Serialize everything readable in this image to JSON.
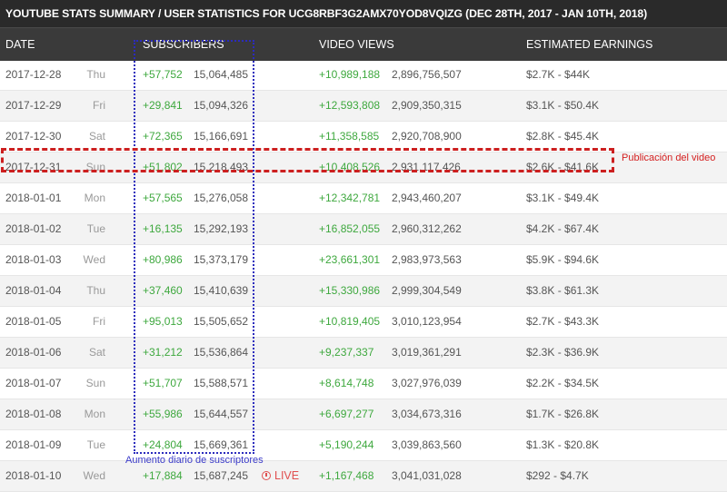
{
  "banner_title": "YOUTUBE STATS SUMMARY / USER STATISTICS FOR UCG8RBF3G2AMX70YOD8VQIZG (DEC 28TH, 2017 - JAN 10TH, 2018)",
  "columns": {
    "date": "DATE",
    "subscribers": "SUBSCRIBERS",
    "video_views": "VIDEO VIEWS",
    "earnings": "ESTIMATED EARNINGS"
  },
  "rows": [
    {
      "date": "2017-12-28",
      "day": "Thu",
      "sub_delta": "+57,752",
      "sub_total": "15,064,485",
      "views_delta": "+10,989,188",
      "views_total": "2,896,756,507",
      "earnings": "$2.7K  -  $44K"
    },
    {
      "date": "2017-12-29",
      "day": "Fri",
      "sub_delta": "+29,841",
      "sub_total": "15,094,326",
      "views_delta": "+12,593,808",
      "views_total": "2,909,350,315",
      "earnings": "$3.1K  -  $50.4K"
    },
    {
      "date": "2017-12-30",
      "day": "Sat",
      "sub_delta": "+72,365",
      "sub_total": "15,166,691",
      "views_delta": "+11,358,585",
      "views_total": "2,920,708,900",
      "earnings": "$2.8K  -  $45.4K"
    },
    {
      "date": "2017-12-31",
      "day": "Sun",
      "sub_delta": "+51,802",
      "sub_total": "15,218,493",
      "views_delta": "+10,408,526",
      "views_total": "2,931,117,426",
      "earnings": "$2.6K  -  $41.6K"
    },
    {
      "date": "2018-01-01",
      "day": "Mon",
      "sub_delta": "+57,565",
      "sub_total": "15,276,058",
      "views_delta": "+12,342,781",
      "views_total": "2,943,460,207",
      "earnings": "$3.1K  -  $49.4K"
    },
    {
      "date": "2018-01-02",
      "day": "Tue",
      "sub_delta": "+16,135",
      "sub_total": "15,292,193",
      "views_delta": "+16,852,055",
      "views_total": "2,960,312,262",
      "earnings": "$4.2K  -  $67.4K"
    },
    {
      "date": "2018-01-03",
      "day": "Wed",
      "sub_delta": "+80,986",
      "sub_total": "15,373,179",
      "views_delta": "+23,661,301",
      "views_total": "2,983,973,563",
      "earnings": "$5.9K  -  $94.6K"
    },
    {
      "date": "2018-01-04",
      "day": "Thu",
      "sub_delta": "+37,460",
      "sub_total": "15,410,639",
      "views_delta": "+15,330,986",
      "views_total": "2,999,304,549",
      "earnings": "$3.8K  -  $61.3K"
    },
    {
      "date": "2018-01-05",
      "day": "Fri",
      "sub_delta": "+95,013",
      "sub_total": "15,505,652",
      "views_delta": "+10,819,405",
      "views_total": "3,010,123,954",
      "earnings": "$2.7K  -  $43.3K"
    },
    {
      "date": "2018-01-06",
      "day": "Sat",
      "sub_delta": "+31,212",
      "sub_total": "15,536,864",
      "views_delta": "+9,237,337",
      "views_total": "3,019,361,291",
      "earnings": "$2.3K  -  $36.9K"
    },
    {
      "date": "2018-01-07",
      "day": "Sun",
      "sub_delta": "+51,707",
      "sub_total": "15,588,571",
      "views_delta": "+8,614,748",
      "views_total": "3,027,976,039",
      "earnings": "$2.2K  -  $34.5K"
    },
    {
      "date": "2018-01-08",
      "day": "Mon",
      "sub_delta": "+55,986",
      "sub_total": "15,644,557",
      "views_delta": "+6,697,277",
      "views_total": "3,034,673,316",
      "earnings": "$1.7K  -  $26.8K"
    },
    {
      "date": "2018-01-09",
      "day": "Tue",
      "sub_delta": "+24,804",
      "sub_total": "15,669,361",
      "views_delta": "+5,190,244",
      "views_total": "3,039,863,560",
      "earnings": "$1.3K  -  $20.8K"
    },
    {
      "date": "2018-01-10",
      "day": "Wed",
      "sub_delta": "+17,884",
      "sub_total": "15,687,245",
      "views_delta": "+1,167,468",
      "views_total": "3,041,031,028",
      "earnings": "$292  -  $4.7K"
    }
  ],
  "live_label": "LIVE",
  "live_icon": "clock-icon",
  "annotations": {
    "publication_label": "Publicación del video",
    "subscribers_caption": "Aumento diario de suscriptores",
    "publication_box_color": "#cc1f1f",
    "subscribers_box_color": "#2b2bbd"
  },
  "colors": {
    "banner_bg": "#2a2a2a",
    "header_bg": "#3a3a3a",
    "delta_green": "#3ea83e",
    "live_red": "#e05050"
  }
}
